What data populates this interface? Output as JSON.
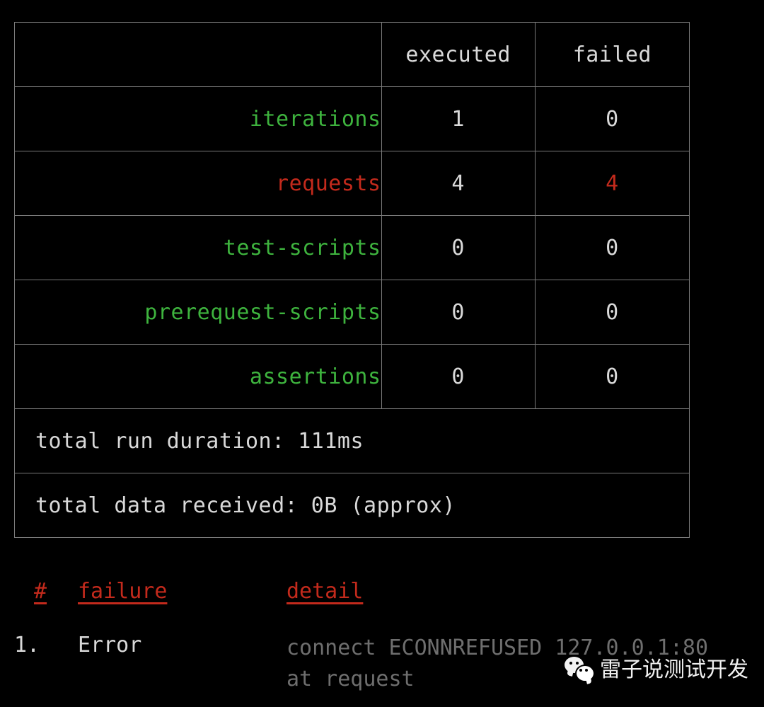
{
  "terminal": {
    "background": "#000000",
    "default_text_color": "#d9d9d9",
    "green": "#3eb33e",
    "red": "#c32a1c",
    "dim": "#6e6e6e",
    "border": "#7a7a7a"
  },
  "summary_table": {
    "headers": [
      "",
      "executed",
      "failed"
    ],
    "rows": [
      {
        "label": "iterations",
        "label_color": "green",
        "executed": "1",
        "failed": "0",
        "failed_color": "default"
      },
      {
        "label": "requests",
        "label_color": "red",
        "executed": "4",
        "failed": "4",
        "failed_color": "red"
      },
      {
        "label": "test-scripts",
        "label_color": "green",
        "executed": "0",
        "failed": "0",
        "failed_color": "default"
      },
      {
        "label": "prerequest-scripts",
        "label_color": "green",
        "executed": "0",
        "failed": "0",
        "failed_color": "default"
      },
      {
        "label": "assertions",
        "label_color": "green",
        "executed": "0",
        "failed": "0",
        "failed_color": "default"
      }
    ],
    "totals": [
      "total run duration: 111ms",
      "total data received: 0B (approx)"
    ]
  },
  "failures": {
    "headers": {
      "index": "#",
      "failure": "failure",
      "detail": "detail"
    },
    "items": [
      {
        "index": "1.",
        "name": "Error",
        "detail_lines": [
          "connect ECONNREFUSED 127.0.0.1:80",
          "at request"
        ]
      }
    ]
  },
  "watermark": {
    "icon": "wechat-logo-icon",
    "text": "雷子说测试开发"
  }
}
